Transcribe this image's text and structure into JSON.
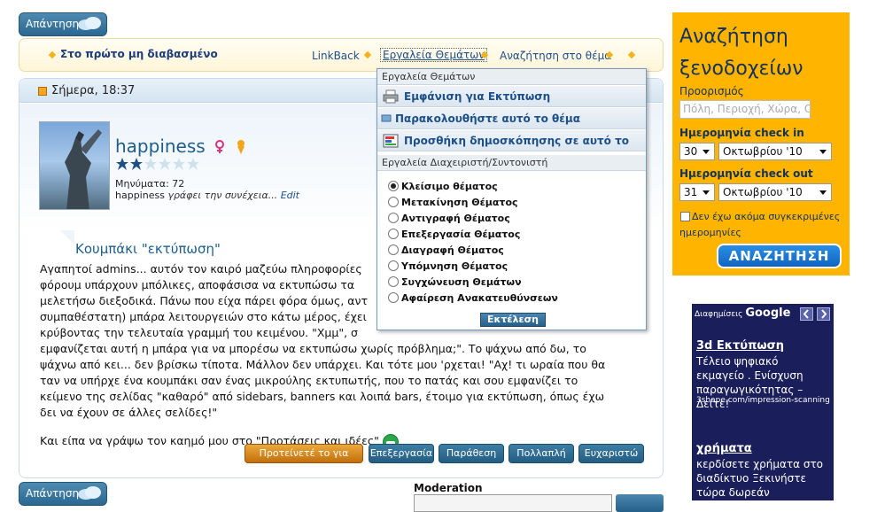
{
  "reply_label": "Απάντηση",
  "nav": {
    "first_unread": "Στο πρώτο μη διαβασμένο",
    "links": [
      "LinkBack",
      "Εργαλεία Θεμάτων",
      "Αναζήτηση στο θέμα"
    ]
  },
  "post": {
    "date": "Σήμερα, 18:37",
    "username": "happiness",
    "posts_count": "Μηνύματα: 72",
    "status_user": "happiness",
    "status_writes": "γράφει την συνέχεια...",
    "status_edit": "Edit",
    "title": "Κουμπάκι \"εκτύπωση\"",
    "body_lines_1": [
      "Αγαπητοί admins... αυτόν τον καιρό μαζεύω πληροφορίες",
      "φόρουμ υπάρχουν μπόλικες, αποφάσισα να εκτυπώσω τα",
      "μελετήσω διεξοδικά. Πάνω που είχα πάρει φόρα όμως, αντ",
      "συμπαθέστατη) μπάρα λειτουργειών στο κάτω μέρος, έχει",
      "κρύβοντας την τελευταία γραμμή του κειμένου. \"Χμμ\", σ",
      "εμφανίζεται αυτή η μπάρα για να μπορέσω να εκτυπώσω χωρίς πρόβλημα;\". Το ψάχνω από δω, το",
      "ψάχνω από κει... δεν βρίσκω τίποτα. Μάλλον δεν υπάρχει. Και τότε μου 'ρχεται! \"Αχ! τι ωραία που θα",
      "ταν να υπήρχε ένα κουμπάκι σαν ένας μικρούλης εκτυπωτής, που το πατάς και σου εμφανίζει το",
      "κείμενο της σελίδας \"καθαρό\" από sidebars, banners και λοιπά bars, έτοιμο για εκτύπωση, όπως έχω",
      "δει να έχουν σε άλλες σελίδες!\""
    ],
    "body_last": "Και είπα να γράψω τον καημό μου στο \"Προτάσεις και ιδέες\"",
    "buttons": [
      "Προτείνετέ το για άρθρο",
      "Επεξεργασία",
      "Παράθεση",
      "Πολλαπλή",
      "Ευχαριστώ"
    ]
  },
  "dropdown": {
    "section1": "Εργαλεία Θεμάτων",
    "items": [
      "Εμφάνιση για Εκτύπωση",
      "Παρακολουθήστε αυτό το θέμα",
      "Προσθήκη δημοσκόπησης σε αυτό το θέμα"
    ],
    "section2": "Εργαλεία Διαχειριστή/Συντονιστή",
    "radios": [
      "Κλείσιμο θέματος",
      "Μετακίνηση Θέματος",
      "Αντιγραφή Θέματος",
      "Επεξεργασία Θέματος",
      "Διαγραφή Θέματος",
      "Υπόμνηση Θέματος",
      "Συγχώνευση Θεμάτων",
      "Αφαίρεση Ανακατευθύνσεων"
    ],
    "exec": "Εκτέλεση"
  },
  "moderation_label": "Moderation",
  "hotel": {
    "title_1": "Αναζήτηση",
    "title_2": "ξενοδοχείων",
    "destination_label": "Προορισμός",
    "destination_placeholder": "Πόλη, Περιοχή, Χώρα, Ο",
    "checkin_label": "Ημερομηνία check in",
    "checkin_day": "30",
    "checkin_month": "Οκτωβρίου '10",
    "checkout_label": "Ημερομηνία check out",
    "checkout_day": "31",
    "checkout_month": "Οκτωβρίου '10",
    "no_dates": "Δεν έχω ακόμα συγκεκριμένες ημερομηνίες",
    "search_button": "ΑΝΑΖΗΤΗΣΗ"
  },
  "ads": {
    "head_prefix": "Διαφημίσεις",
    "head_brand": "Google",
    "ad1_title": "3d Εκτύπωση",
    "ad1_text": "Τέλειο ψηφιακό εκμαγείο . Ενίσχυση παραγωγικότητας – Δείτε!",
    "ad1_url": "3shape.com/impression-scanning",
    "ad2_title": "χρήματα",
    "ad2_text": "κερδίσετε χρήματα στο διαδίκτυο Ξεκινήστε τώρα δωρεάν"
  }
}
